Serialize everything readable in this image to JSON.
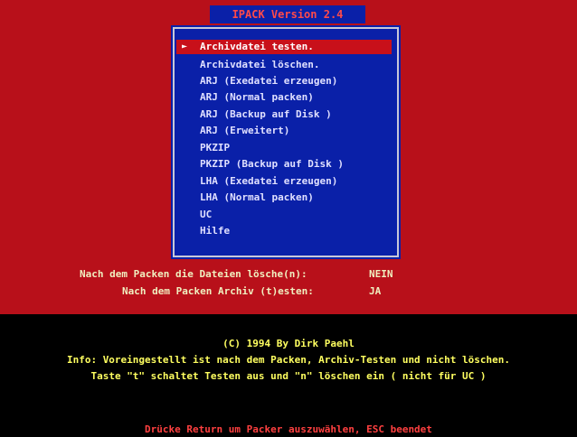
{
  "title": "IPACK Version 2.4",
  "menu": {
    "items": [
      {
        "label": "Archivdatei testen.",
        "selected": true
      },
      {
        "label": "Archivdatei löschen."
      },
      {
        "label": "ARJ (Exedatei erzeugen)"
      },
      {
        "label": "ARJ (Normal packen)"
      },
      {
        "label": "ARJ (Backup auf Disk )"
      },
      {
        "label": "ARJ (Erweitert)"
      },
      {
        "label": "PKZIP"
      },
      {
        "label": "PKZIP (Backup auf Disk )"
      },
      {
        "label": "LHA (Exedatei erzeugen)"
      },
      {
        "label": "LHA (Normal packen)"
      },
      {
        "label": "UC"
      },
      {
        "label": "Hilfe"
      }
    ],
    "selected_marker": "►"
  },
  "options": {
    "delete_label": "Nach dem Packen die Dateien lösche(n):",
    "delete_value": "NEIN",
    "test_label": "Nach dem Packen Archiv (t)esten:",
    "test_value": "JA"
  },
  "info": {
    "copyright": "(C) 1994 By Dirk Paehl",
    "line1": "Info: Voreingestellt ist nach dem Packen, Archiv-Testen und nicht löschen.",
    "line2": "Taste \"t\" schaltet Testen aus und \"n\" löschen ein ( nicht für UC )"
  },
  "footer": "Drücke Return um Packer auszuwählen, ESC beendet",
  "colors": {
    "background_top": "#b8101a",
    "menu_blue": "#0a20a8",
    "highlight": "#c8101a",
    "info_yellow": "#ffff60",
    "footer_red": "#ff4040"
  }
}
